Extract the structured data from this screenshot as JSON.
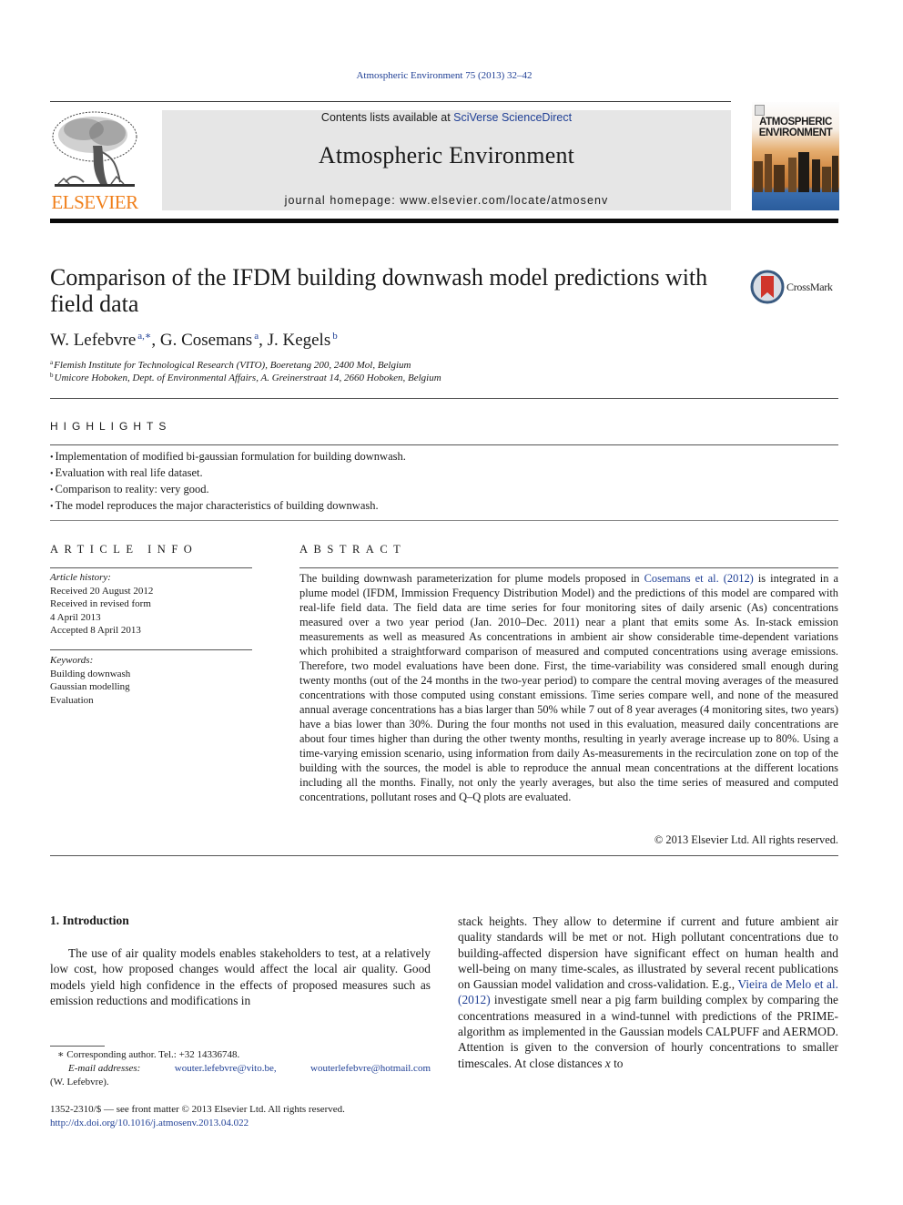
{
  "journal_citation": "Atmospheric Environment 75 (2013) 32–42",
  "header": {
    "publisher_logo_text": "ELSEVIER",
    "contents_prefix": "Contents lists available at ",
    "contents_link": "SciVerse ScienceDirect",
    "journal_title": "Atmospheric Environment",
    "homepage": "journal homepage: www.elsevier.com/locate/atmosenv",
    "cover_title_line1": "ATMOSPHERIC",
    "cover_title_line2": "ENVIRONMENT"
  },
  "colors": {
    "link": "#1f3f95",
    "elsevier_orange": "#f07f1a",
    "banner_gray": "#e6e6e6"
  },
  "article": {
    "title": "Comparison of the IFDM building downwash model predictions with field data",
    "crossmark_label": "CrossMark",
    "authors": [
      {
        "name": "W. Lefebvre",
        "sup": "a,∗"
      },
      {
        "name": "G. Cosemans",
        "sup": "a"
      },
      {
        "name": "J. Kegels",
        "sup": "b"
      }
    ],
    "affiliations": [
      {
        "mark": "a",
        "text": "Flemish Institute for Technological Research (VITO), Boeretang 200, 2400 Mol, Belgium"
      },
      {
        "mark": "b",
        "text": "Umicore Hoboken, Dept. of Environmental Affairs, A. Greinerstraat 14, 2660 Hoboken, Belgium"
      }
    ]
  },
  "highlights": {
    "heading": "HIGHLIGHTS",
    "items": [
      "Implementation of modified bi-gaussian formulation for building downwash.",
      "Evaluation with real life dataset.",
      "Comparison to reality: very good.",
      "The model reproduces the major characteristics of building downwash."
    ]
  },
  "article_info": {
    "heading": "ARTICLE INFO",
    "history_label": "Article history:",
    "history": [
      "Received 20 August 2012",
      "Received in revised form",
      "4 April 2013",
      "Accepted 8 April 2013"
    ],
    "keywords_label": "Keywords:",
    "keywords": [
      "Building downwash",
      "Gaussian modelling",
      "Evaluation"
    ]
  },
  "abstract": {
    "heading": "ABSTRACT",
    "text_before_link": "The building downwash parameterization for plume models proposed in ",
    "link": "Cosemans et al. (2012)",
    "text_after_link": " is integrated in a plume model (IFDM, Immission Frequency Distribution Model) and the predictions of this model are compared with real-life field data. The field data are time series for four monitoring sites of daily arsenic (As) concentrations measured over a two year period (Jan. 2010–Dec. 2011) near a plant that emits some As. In-stack emission measurements as well as measured As concentrations in ambient air show considerable time-dependent variations which prohibited a straightforward comparison of measured and computed concentrations using average emissions. Therefore, two model evaluations have been done. First, the time-variability was considered small enough during twenty months (out of the 24 months in the two-year period) to compare the central moving averages of the measured concentrations with those computed using constant emissions. Time series compare well, and none of the measured annual average concentrations has a bias larger than 50% while 7 out of 8 year averages (4 monitoring sites, two years) have a bias lower than 30%. During the four months not used in this evaluation, measured daily concentrations are about four times higher than during the other twenty months, resulting in yearly average increase up to 80%. Using a time-varying emission scenario, using information from daily As-measurements in the recirculation zone on top of the building with the sources, the model is able to reproduce the annual mean concentrations at the different locations including all the months. Finally, not only the yearly averages, but also the time series of measured and computed concentrations, pollutant roses and Q–Q plots are evaluated.",
    "copyright": "© 2013 Elsevier Ltd. All rights reserved."
  },
  "introduction": {
    "heading": "1.  Introduction",
    "left_text": "The use of air quality models enables stakeholders to test, at a relatively low cost, how proposed changes would affect the local air quality. Good models yield high confidence in the effects of proposed measures such as emission reductions and modifications in",
    "right_text_before_link": "stack heights. They allow to determine if current and future ambient air quality standards will be met or not. High pollutant concentrations due to building-affected dispersion have significant effect on human health and well-being on many time-scales, as illustrated by several recent publications on Gaussian model validation and cross-validation. E.g., ",
    "right_link": "Vieira de Melo et al. (2012)",
    "right_text_after_link": " investigate smell near a pig farm building complex by comparing the concentrations measured in a wind-tunnel with predictions of the PRIME-algorithm as implemented in the Gaussian models CALPUFF and AERMOD. Attention is given to the conversion of hourly concentrations to smaller timescales. At close distances ",
    "right_italic_x": "x",
    "right_text_end": " to"
  },
  "footnotes": {
    "corresponding": "∗  Corresponding author. Tel.: +32 14336748.",
    "email_label": "E-mail addresses:",
    "emails": [
      "wouter.lefebvre@vito.be,",
      "wouterlefebvre@hotmail.com"
    ],
    "email_owner": "(W. Lefebvre).",
    "front_matter": "1352-2310/$ — see front matter © 2013 Elsevier Ltd. All rights reserved.",
    "doi": "http://dx.doi.org/10.1016/j.atmosenv.2013.04.022"
  }
}
